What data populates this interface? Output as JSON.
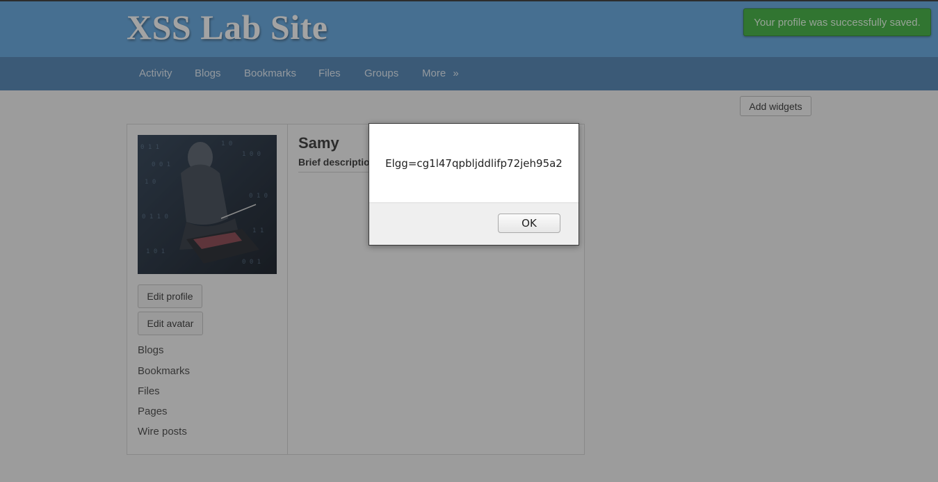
{
  "header": {
    "site_title": "XSS Lab Site",
    "notification": "Your profile was successfully saved."
  },
  "nav": {
    "items": [
      "Activity",
      "Blogs",
      "Bookmarks",
      "Files",
      "Groups"
    ],
    "more_label": "More",
    "more_icon": "»"
  },
  "main": {
    "add_widgets_label": "Add widgets"
  },
  "profile": {
    "name": "Samy",
    "brief_description_label": "Brief description",
    "edit_profile_label": "Edit profile",
    "edit_avatar_label": "Edit avatar",
    "links": [
      "Blogs",
      "Bookmarks",
      "Files",
      "Pages",
      "Wire posts"
    ]
  },
  "dialog": {
    "message": "Elgg=cg1l47qpbljddlifp72jeh95a2",
    "ok_label": "OK"
  },
  "colors": {
    "header_bg": "#60a6e0",
    "navbar_bg": "#4c82b3",
    "toast_bg": "#3cb03c"
  }
}
